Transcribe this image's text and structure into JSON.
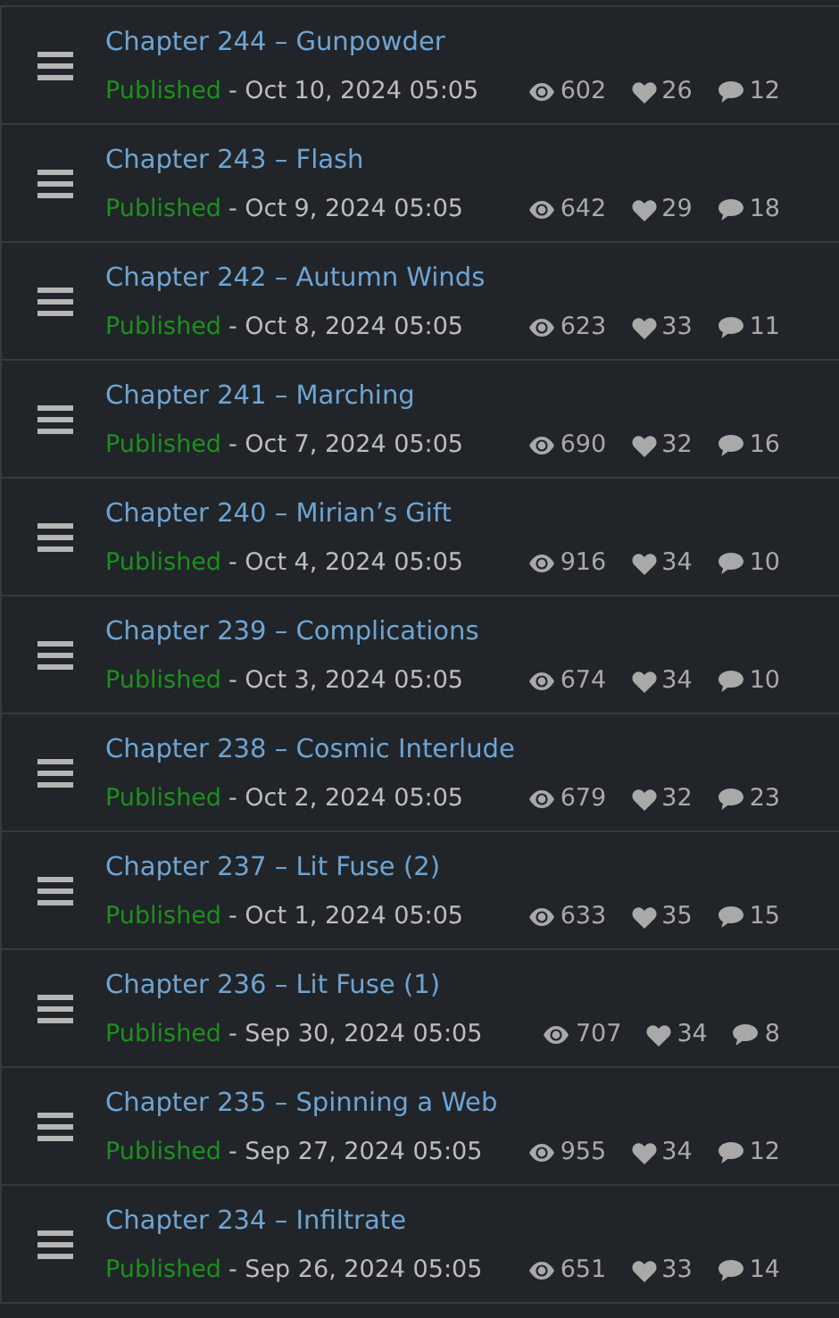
{
  "chapters": [
    {
      "title": "Chapter 244 – Gunpowder",
      "status": "Published",
      "date": "- Oct 10, 2024 05:05",
      "views": "602",
      "likes": "26",
      "comments": "12"
    },
    {
      "title": "Chapter 243 – Flash",
      "status": "Published",
      "date": "- Oct 9, 2024 05:05",
      "views": "642",
      "likes": "29",
      "comments": "18"
    },
    {
      "title": "Chapter 242 – Autumn Winds",
      "status": "Published",
      "date": "- Oct 8, 2024 05:05",
      "views": "623",
      "likes": "33",
      "comments": "11"
    },
    {
      "title": "Chapter 241 – Marching",
      "status": "Published",
      "date": "- Oct 7, 2024 05:05",
      "views": "690",
      "likes": "32",
      "comments": "16"
    },
    {
      "title": "Chapter 240 – Mirian’s Gift",
      "status": "Published",
      "date": "- Oct 4, 2024 05:05",
      "views": "916",
      "likes": "34",
      "comments": "10"
    },
    {
      "title": "Chapter 239 – Complications",
      "status": "Published",
      "date": "- Oct 3, 2024 05:05",
      "views": "674",
      "likes": "34",
      "comments": "10"
    },
    {
      "title": "Chapter 238 – Cosmic Interlude",
      "status": "Published",
      "date": "- Oct 2, 2024 05:05",
      "views": "679",
      "likes": "32",
      "comments": "23"
    },
    {
      "title": "Chapter 237 – Lit Fuse (2)",
      "status": "Published",
      "date": "- Oct 1, 2024 05:05",
      "views": "633",
      "likes": "35",
      "comments": "15"
    },
    {
      "title": "Chapter 236 – Lit Fuse (1)",
      "status": "Published",
      "date": "- Sep 30, 2024 05:05",
      "views": "707",
      "likes": "34",
      "comments": "8"
    },
    {
      "title": "Chapter 235 – Spinning a Web",
      "status": "Published",
      "date": "- Sep 27, 2024 05:05",
      "views": "955",
      "likes": "34",
      "comments": "12"
    },
    {
      "title": "Chapter 234 – Infiltrate",
      "status": "Published",
      "date": "- Sep 26, 2024 05:05",
      "views": "651",
      "likes": "33",
      "comments": "14"
    }
  ]
}
